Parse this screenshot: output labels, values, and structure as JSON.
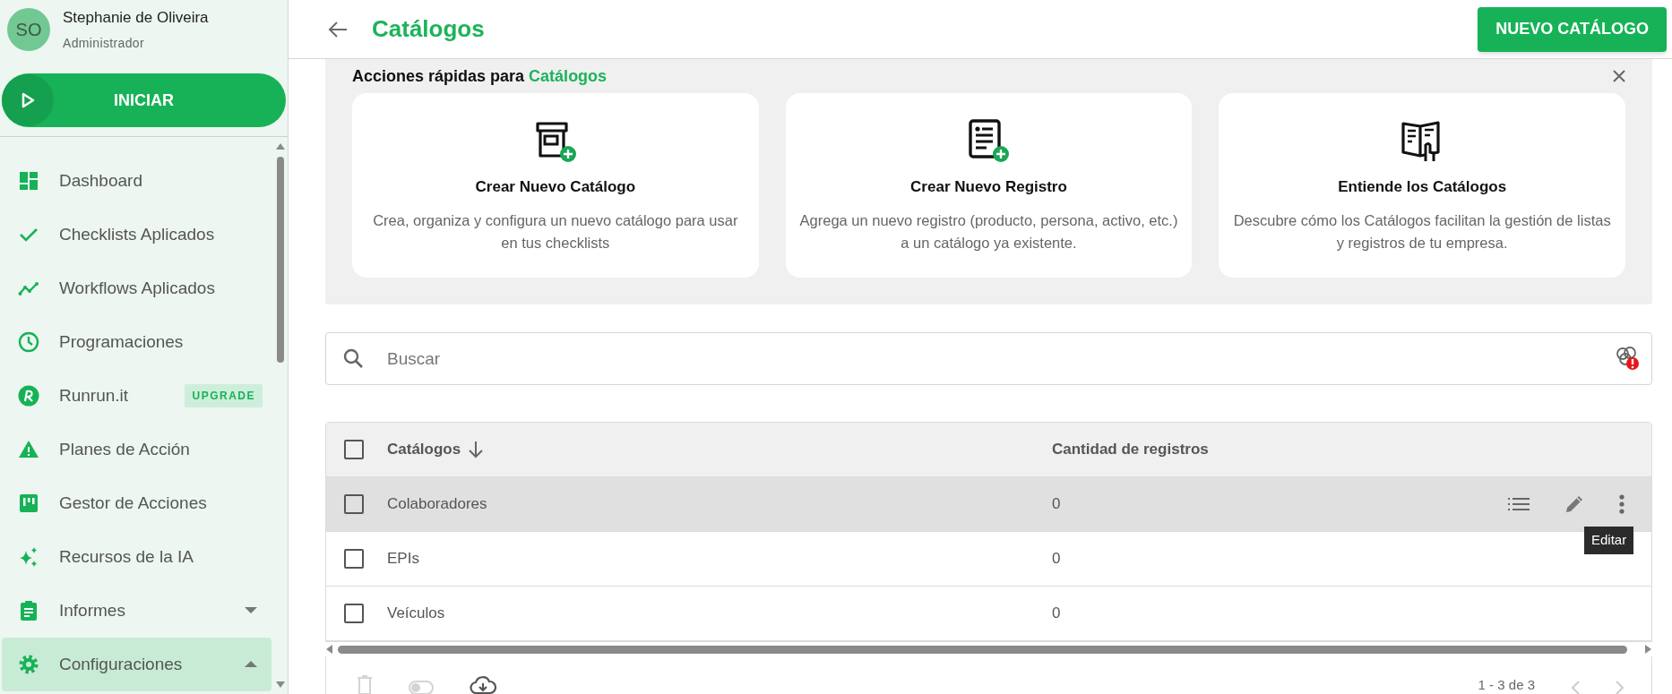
{
  "user": {
    "initials": "SO",
    "name": "Stephanie de Oliveira",
    "role": "Administrador"
  },
  "start_button": {
    "label": "INICIAR"
  },
  "nav": [
    {
      "label": "Dashboard",
      "selected": false
    },
    {
      "label": "Checklists Aplicados",
      "selected": false
    },
    {
      "label": "Workflows Aplicados",
      "selected": false
    },
    {
      "label": "Programaciones",
      "selected": false
    },
    {
      "label": "Runrun.it",
      "selected": false,
      "badge": "UPGRADE"
    },
    {
      "label": "Planes de Acción",
      "selected": false
    },
    {
      "label": "Gestor de Acciones",
      "selected": false
    },
    {
      "label": "Recursos de la IA",
      "selected": false
    },
    {
      "label": "Informes",
      "selected": false,
      "expanded": false
    },
    {
      "label": "Configuraciones",
      "selected": true,
      "expanded": true
    }
  ],
  "header": {
    "title": "Catálogos",
    "new_button": "NUEVO CATÁLOGO"
  },
  "quick_actions": {
    "heading": "Acciones rápidas para",
    "highlight": "Catálogos",
    "cards": [
      {
        "title": "Crear Nuevo Catálogo",
        "description": "Crea, organiza y configura un nuevo catálogo para usar en tus checklists"
      },
      {
        "title": "Crear Nuevo Registro",
        "description": "Agrega un nuevo registro (producto, persona, activo, etc.) a un catálogo ya existente."
      },
      {
        "title": "Entiende los Catálogos",
        "description": "Descubre cómo los Catálogos facilitan la gestión de listas y registros de tu empresa."
      }
    ]
  },
  "search": {
    "placeholder": "Buscar"
  },
  "table": {
    "select_all_checked": false,
    "columns": [
      {
        "label": "Catálogos",
        "sort_descending": true
      },
      {
        "label": "Cantidad de registros"
      }
    ],
    "rows": [
      {
        "name": "Colaboradores",
        "count": "0",
        "checked": false,
        "hovered": true
      },
      {
        "name": "EPIs",
        "count": "0",
        "checked": false,
        "hovered": false
      },
      {
        "name": "Veículos",
        "count": "0",
        "checked": false,
        "hovered": false
      }
    ],
    "tooltip": "Editar",
    "pagination": "1 - 3 de 3"
  }
}
